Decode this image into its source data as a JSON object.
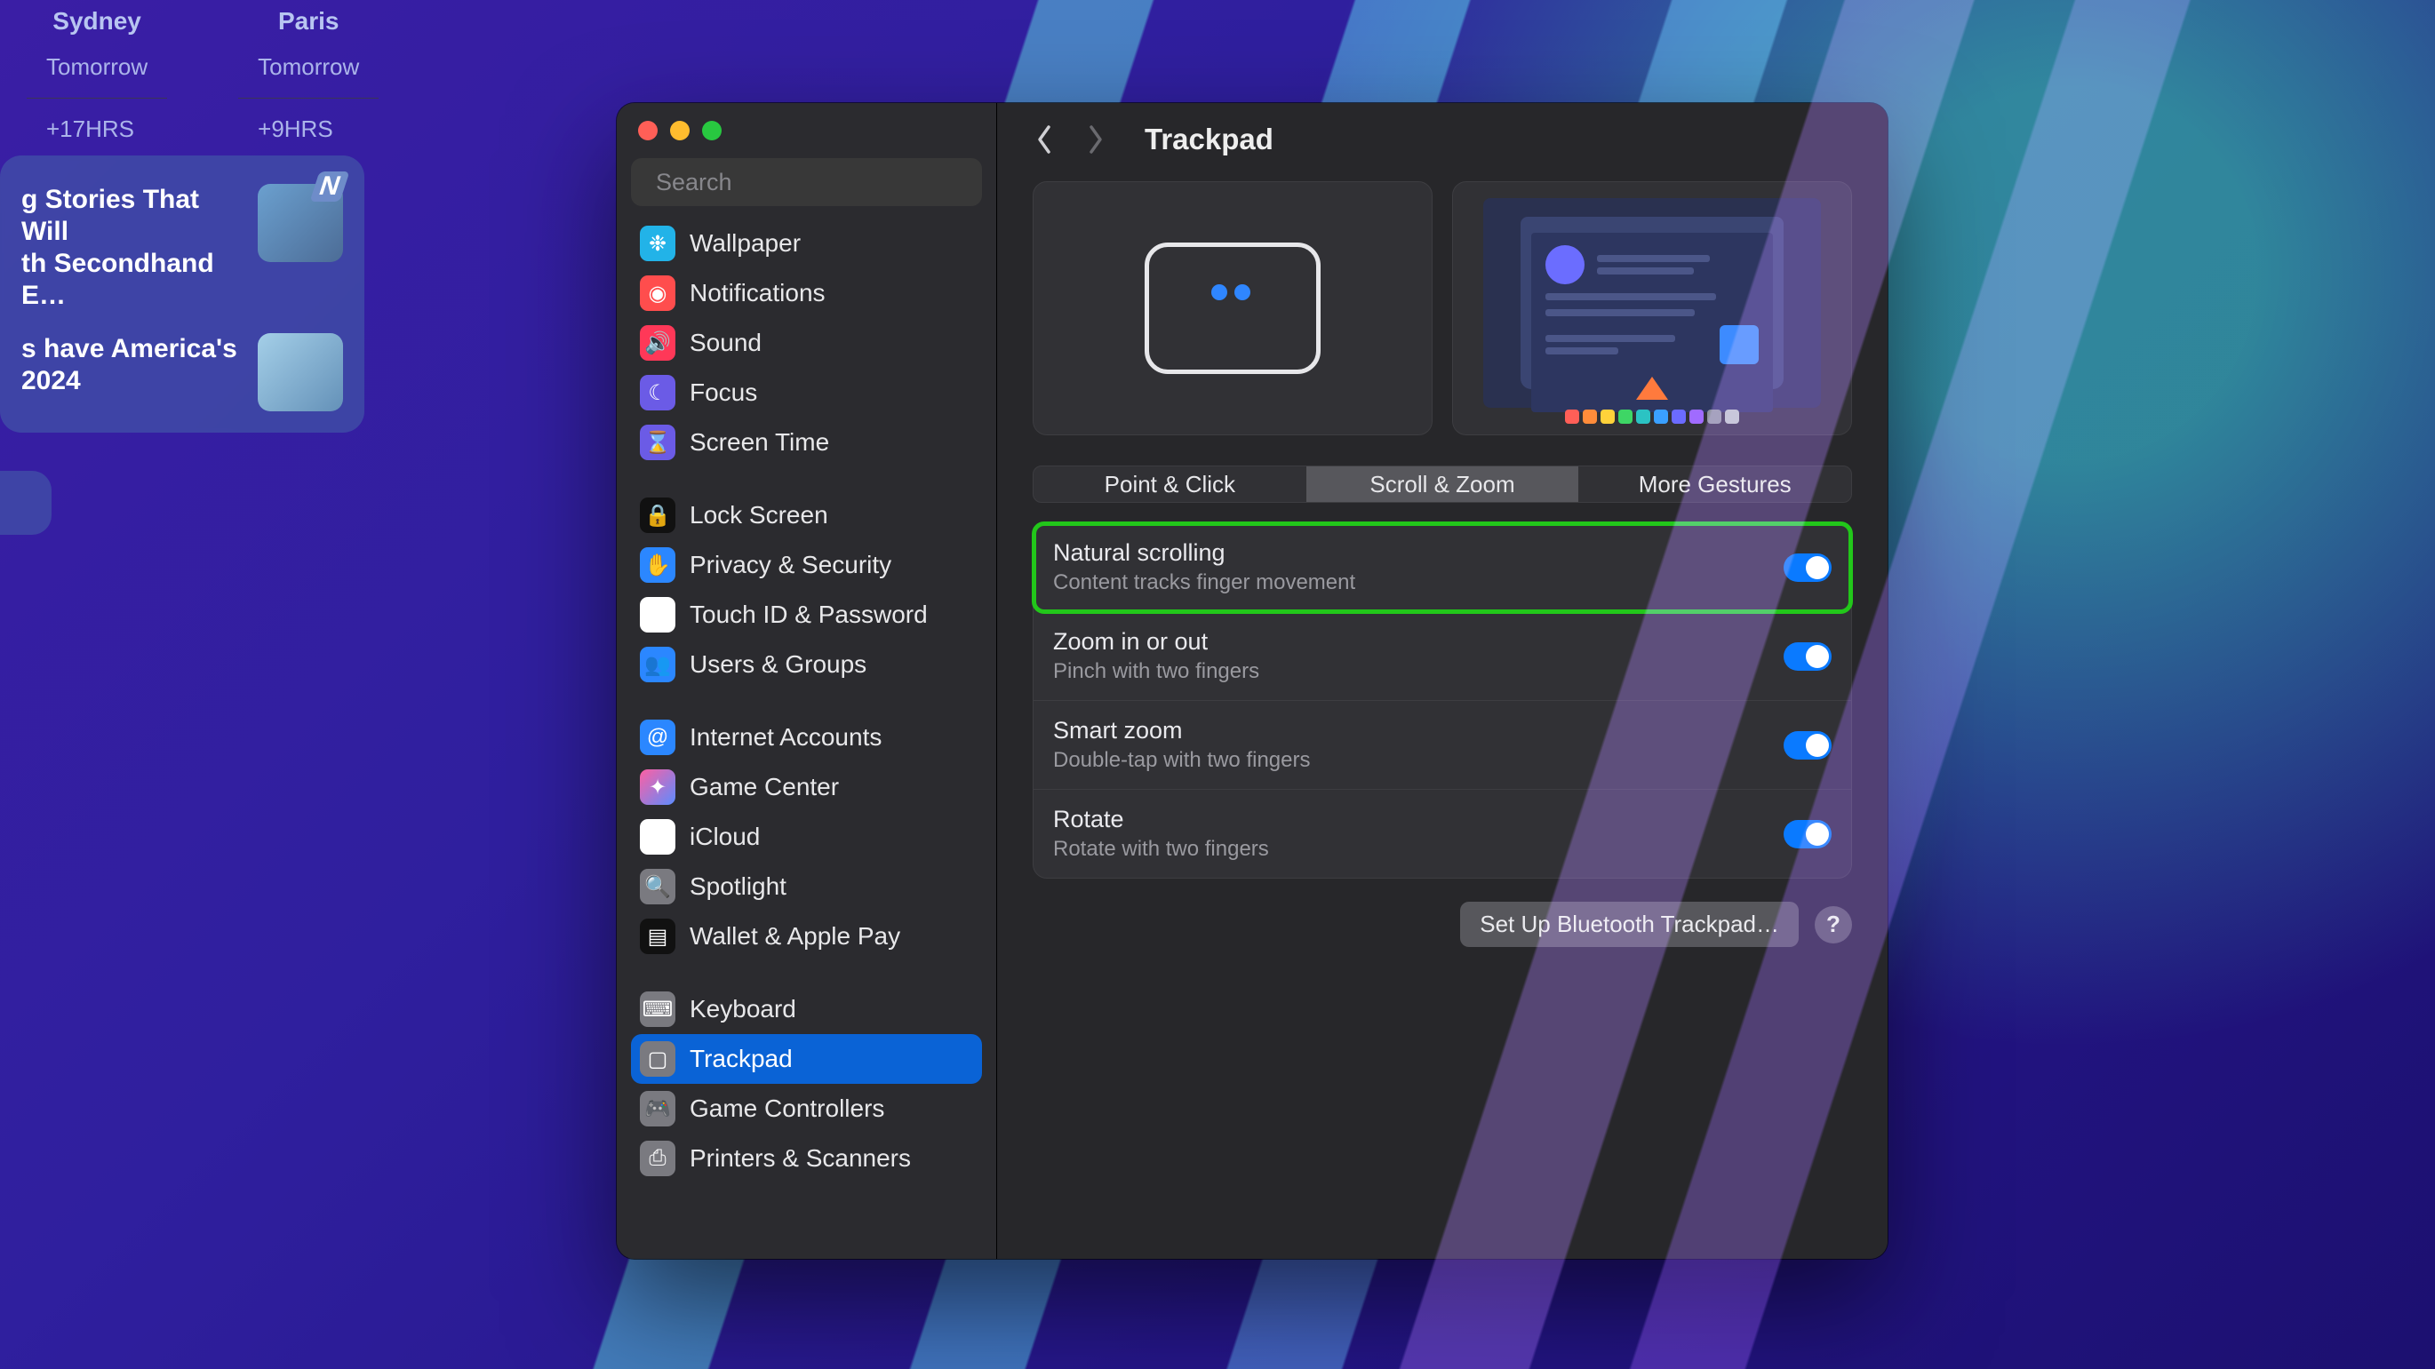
{
  "widgets": {
    "clock": [
      {
        "city": "Sydney",
        "row1": "Tomorrow",
        "row2": "+17HRS"
      },
      {
        "city": "Paris",
        "row1": "Tomorrow",
        "row2": "+9HRS"
      }
    ],
    "news_logo": "N",
    "news": [
      {
        "headline": "g Stories That Will\nth Secondhand E…"
      },
      {
        "headline": "s have America's\n 2024"
      }
    ]
  },
  "search": {
    "placeholder": "Search"
  },
  "sidebar": {
    "groups": [
      [
        {
          "icon": "i-wallpaper",
          "glyph": "❉",
          "label": "Wallpaper"
        },
        {
          "icon": "i-notif",
          "glyph": "◉",
          "label": "Notifications"
        },
        {
          "icon": "i-sound",
          "glyph": "🔊",
          "label": "Sound"
        },
        {
          "icon": "i-focus",
          "glyph": "☾",
          "label": "Focus"
        },
        {
          "icon": "i-screen",
          "glyph": "⌛",
          "label": "Screen Time"
        }
      ],
      [
        {
          "icon": "i-lock",
          "glyph": "🔒",
          "label": "Lock Screen"
        },
        {
          "icon": "i-priv",
          "glyph": "✋",
          "label": "Privacy & Security"
        },
        {
          "icon": "i-touch",
          "glyph": "◉",
          "label": "Touch ID & Password"
        },
        {
          "icon": "i-users",
          "glyph": "👥",
          "label": "Users & Groups"
        }
      ],
      [
        {
          "icon": "i-internet",
          "glyph": "@",
          "label": "Internet Accounts"
        },
        {
          "icon": "i-gc",
          "glyph": "✦",
          "label": "Game Center"
        },
        {
          "icon": "i-icloud",
          "glyph": "☁",
          "label": "iCloud"
        },
        {
          "icon": "i-spot",
          "glyph": "🔍",
          "label": "Spotlight"
        },
        {
          "icon": "i-wallet",
          "glyph": "▤",
          "label": "Wallet & Apple Pay"
        }
      ],
      [
        {
          "icon": "i-kb",
          "glyph": "⌨",
          "label": "Keyboard"
        },
        {
          "icon": "i-track",
          "glyph": "▢",
          "label": "Trackpad",
          "selected": true
        },
        {
          "icon": "i-gctl",
          "glyph": "🎮",
          "label": "Game Controllers"
        },
        {
          "icon": "i-print",
          "glyph": "⎙",
          "label": "Printers & Scanners"
        }
      ]
    ]
  },
  "content": {
    "title": "Trackpad",
    "tabs": [
      "Point & Click",
      "Scroll & Zoom",
      "More Gestures"
    ],
    "tab_selected": 1,
    "rows": [
      {
        "title": "Natural scrolling",
        "sub": "Content tracks finger movement",
        "on": true,
        "highlight": true
      },
      {
        "title": "Zoom in or out",
        "sub": "Pinch with two fingers",
        "on": true
      },
      {
        "title": "Smart zoom",
        "sub": "Double-tap with two fingers",
        "on": true
      },
      {
        "title": "Rotate",
        "sub": "Rotate with two fingers",
        "on": true
      }
    ],
    "footer": {
      "button": "Set Up Bluetooth Trackpad…",
      "help": "?"
    }
  }
}
